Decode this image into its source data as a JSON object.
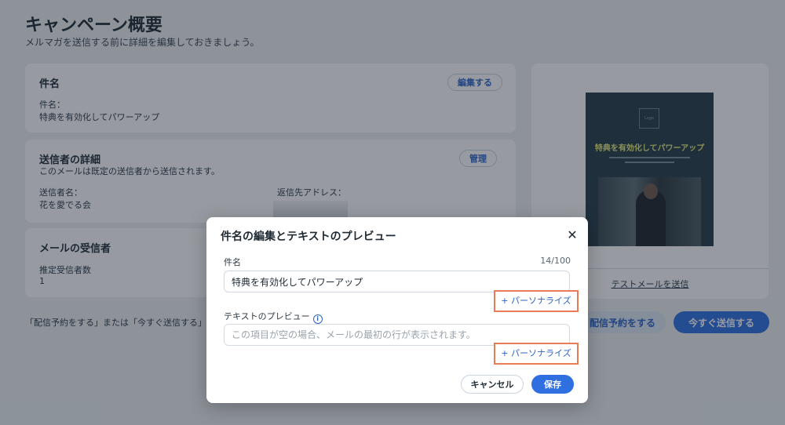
{
  "page": {
    "title": "キャンペーン概要",
    "subtitle": "メルマガを送信する前に詳細を編集しておきましょう。"
  },
  "subject_card": {
    "title": "件名",
    "edit_label": "編集する",
    "field_label": "件名：",
    "value": "特典を有効化してパワーアップ"
  },
  "sender_card": {
    "title": "送信者の詳細",
    "description": "このメールは既定の送信者から送信されます。",
    "manage_label": "管理",
    "sender_name_label": "送信者名：",
    "sender_name": "花を愛でる会",
    "reply_label": "返信先アドレス："
  },
  "recipients_card": {
    "title": "メールの受信者",
    "estimate_label": "推定受信者数",
    "estimate_value": "1"
  },
  "bottom": {
    "note": "「配信予約をする」または「今すぐ送信する」を",
    "schedule_label": "配信予約をする",
    "send_now_label": "今すぐ送信する"
  },
  "preview": {
    "logo_text": "Logo",
    "headline": "特典を有効化してパワーアップ",
    "test_email_label": "テストメールを送信"
  },
  "modal": {
    "title": "件名の編集とテキストのプレビュー",
    "close_symbol": "✕",
    "subject_label": "件名",
    "subject_counter": "14/100",
    "subject_value": "特典を有効化してパワーアップ",
    "personalize_label": "+ パーソナライズ",
    "preview_label": "テキストのプレビュー",
    "info_symbol": "i",
    "preview_placeholder": "この項目が空の場合、メールの最初の行が表示されます。",
    "cancel_label": "キャンセル",
    "save_label": "保存"
  },
  "colors": {
    "accent": "#2f6fe0",
    "highlight_border": "#ea7b57"
  }
}
